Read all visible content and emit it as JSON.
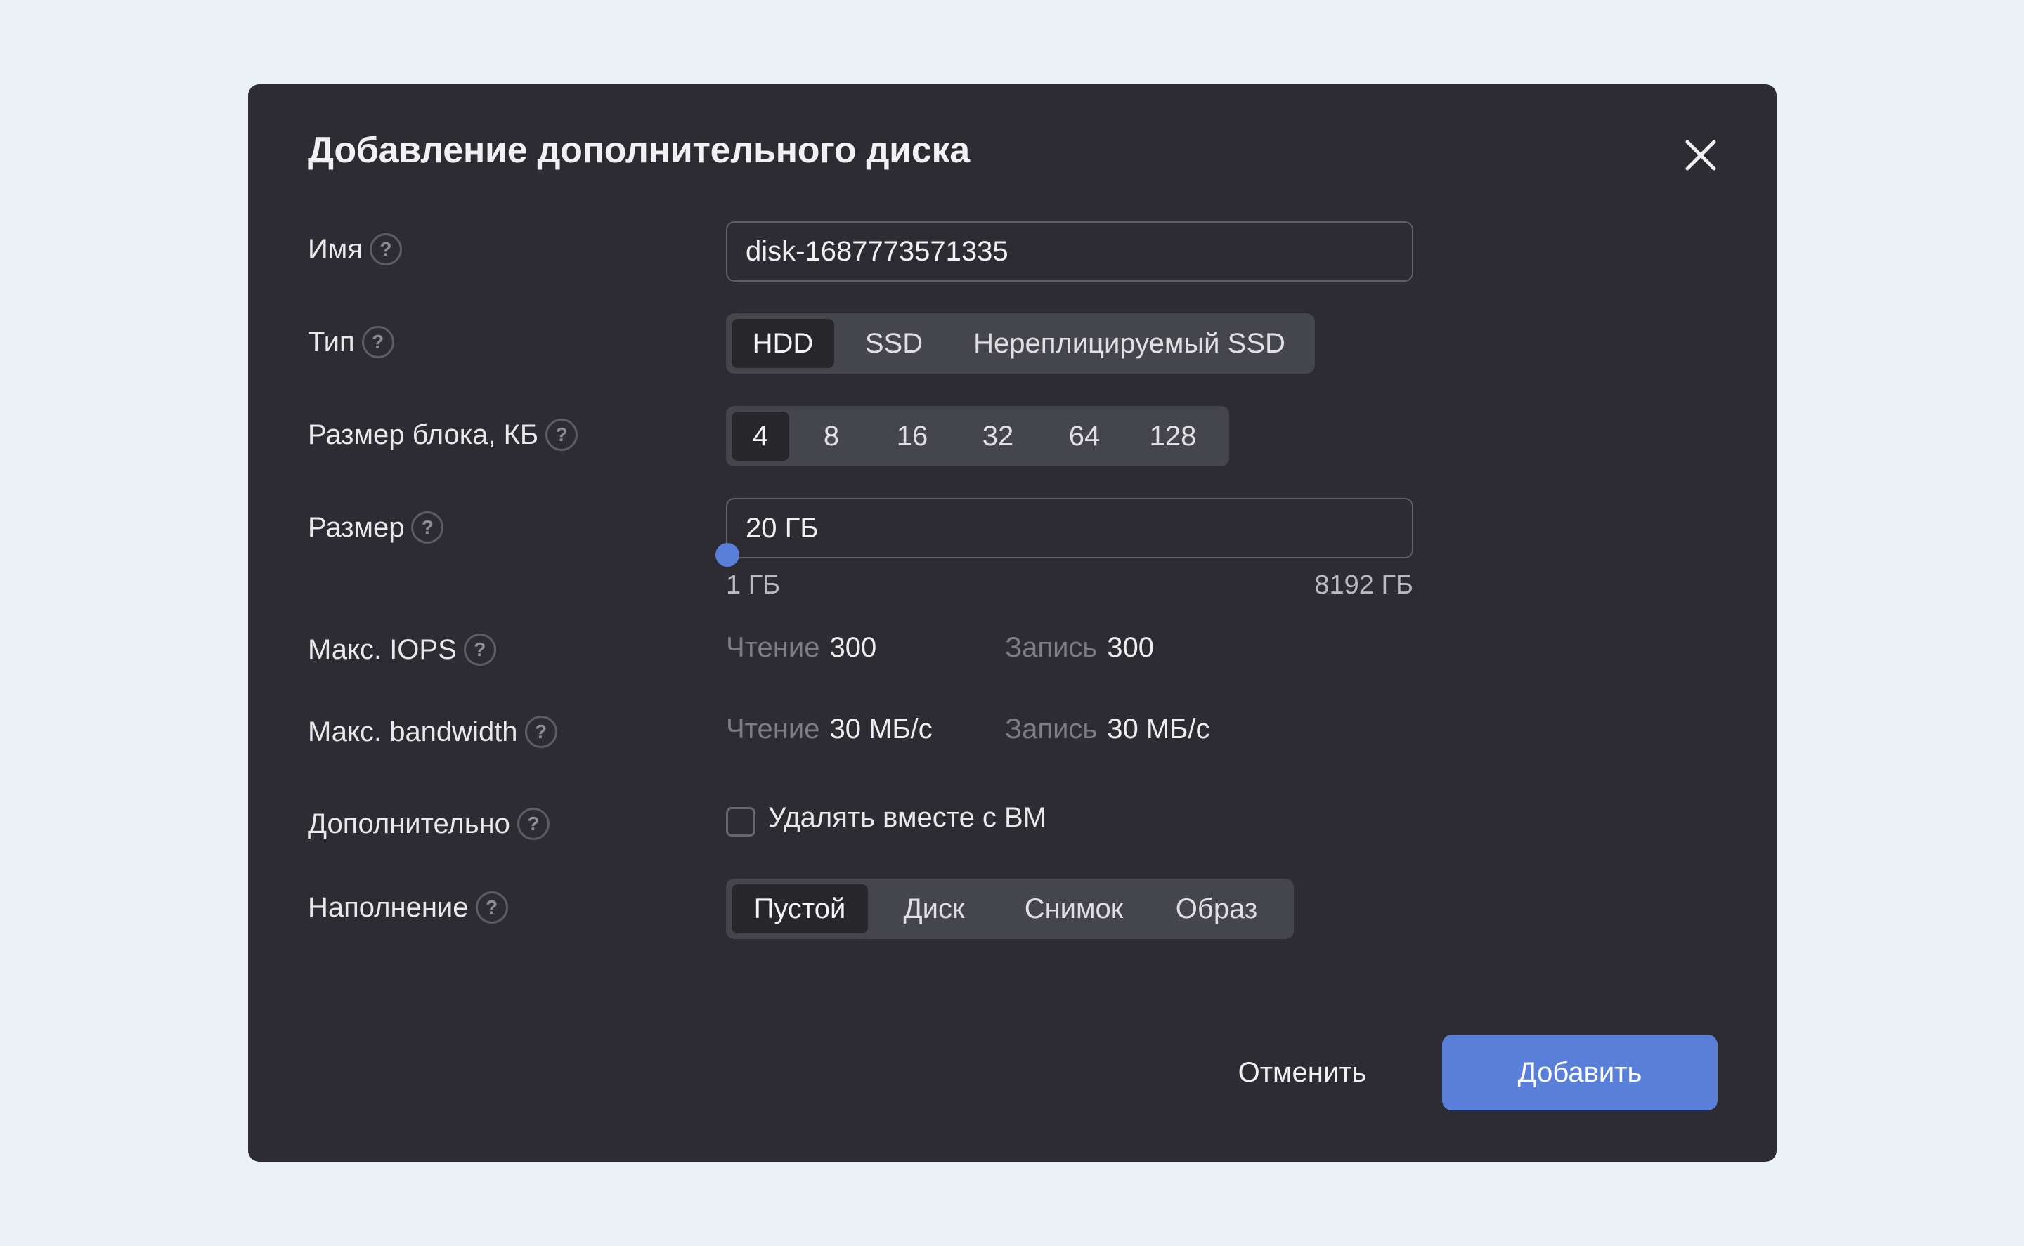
{
  "dialog": {
    "title": "Добавление дополнительного диска",
    "close_icon": "close-icon"
  },
  "name": {
    "label": "Имя",
    "help": "?",
    "value": "disk-1687773571335"
  },
  "type": {
    "label": "Тип",
    "help": "?",
    "options": [
      "HDD",
      "SSD",
      "Нереплицируемый SSD"
    ],
    "selected": "HDD"
  },
  "block_size": {
    "label": "Размер блока, КБ",
    "help": "?",
    "options": [
      "4",
      "8",
      "16",
      "32",
      "64",
      "128"
    ],
    "selected": "4"
  },
  "size": {
    "label": "Размер",
    "help": "?",
    "value": "20 ГБ",
    "min_label": "1 ГБ",
    "max_label": "8192 ГБ",
    "slider_fraction": 0.0
  },
  "iops": {
    "label": "Макс. IOPS",
    "help": "?",
    "read_label": "Чтение",
    "read_value": "300",
    "write_label": "Запись",
    "write_value": "300"
  },
  "bandwidth": {
    "label": "Макс. bandwidth",
    "help": "?",
    "read_label": "Чтение",
    "read_value": "30 МБ/с",
    "write_label": "Запись",
    "write_value": "30 МБ/с"
  },
  "extra": {
    "label": "Дополнительно",
    "help": "?",
    "checkbox_label": "Удалять вместе с ВМ",
    "checked": false
  },
  "fill": {
    "label": "Наполнение",
    "help": "?",
    "options": [
      "Пустой",
      "Диск",
      "Снимок",
      "Образ"
    ],
    "selected": "Пустой"
  },
  "actions": {
    "cancel": "Отменить",
    "add": "Добавить"
  },
  "colors": {
    "accent": "#5a7fd9",
    "dialog_bg": "#2c2c32",
    "page_bg": "#eaf2f5"
  }
}
